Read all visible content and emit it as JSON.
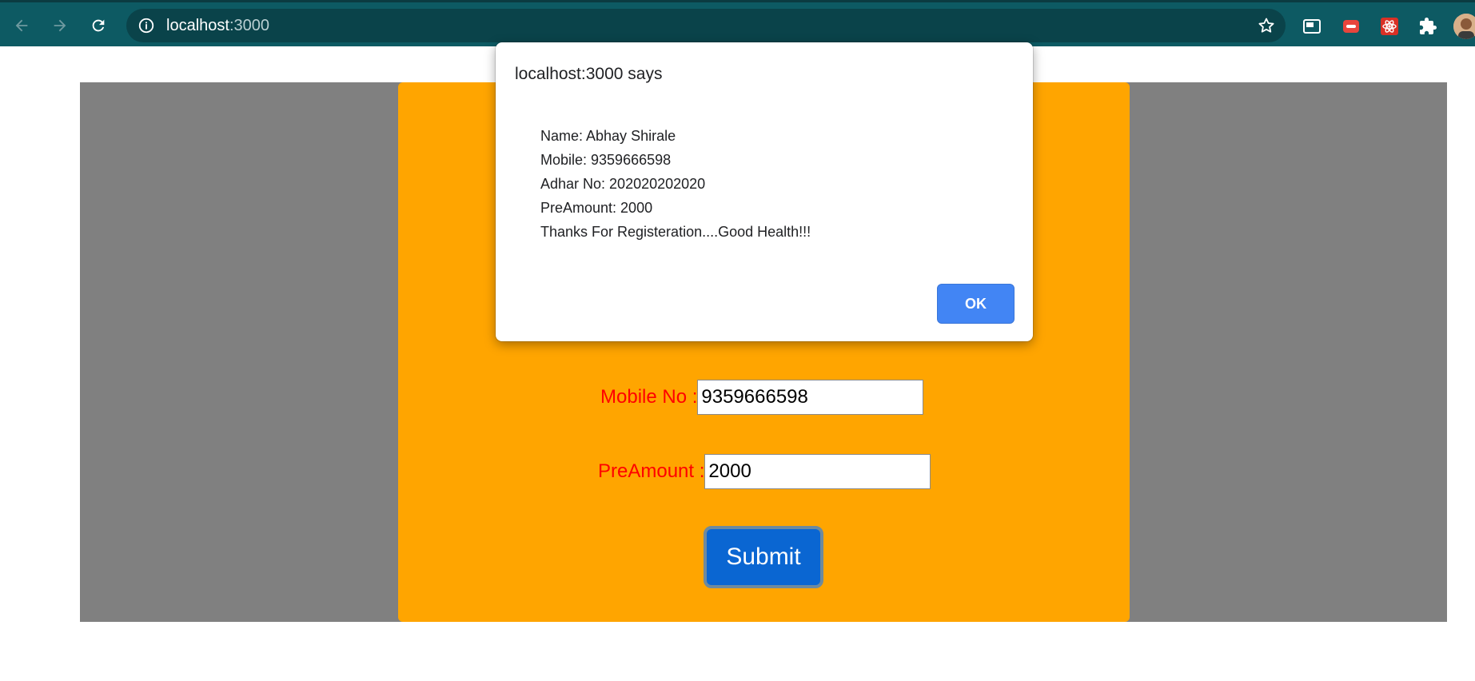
{
  "browser": {
    "url_host": "localhost",
    "url_port": ":3000"
  },
  "form": {
    "mobile_label": "Mobile No :",
    "mobile_value": "9359666598",
    "preamount_label": "PreAmount :",
    "preamount_value": "2000",
    "submit_label": "Submit"
  },
  "dialog": {
    "title": "localhost:3000 says",
    "lines": [
      "Name: Abhay Shirale",
      "Mobile: 9359666598",
      "Adhar No: 202020202020",
      "PreAmount: 2000",
      "Thanks For Registeration....Good Health!!!"
    ],
    "ok_label": "OK"
  },
  "colors": {
    "toolbar": "#0d5a63",
    "page_background": "#808080",
    "form_card": "#ffa500",
    "label_text": "#ff0000",
    "submit_button": "#0a66d2",
    "ok_button": "#4285f4"
  },
  "icons": {
    "back": "arrow-left-icon",
    "forward": "arrow-right-icon",
    "reload": "reload-icon",
    "site_info": "info-icon",
    "bookmark": "star-icon",
    "extensions": [
      "picture-in-picture-icon",
      "red-extension-icon",
      "react-devtools-icon",
      "puzzle-icon"
    ]
  }
}
